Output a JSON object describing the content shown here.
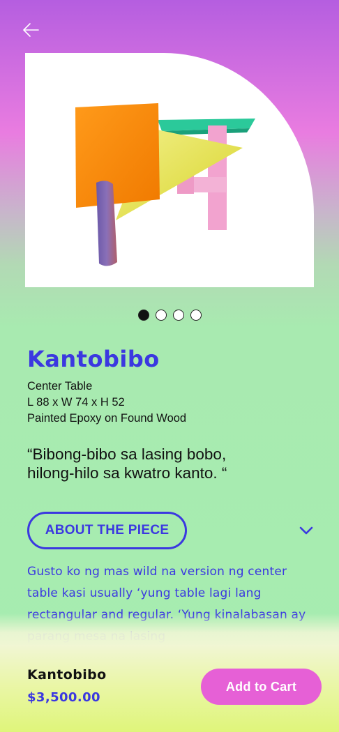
{
  "nav": {
    "back_icon": "arrow-left-icon"
  },
  "product": {
    "name": "Kantobibo",
    "type": "Center Table",
    "dimensions": "L 88 x W 74 x H 52",
    "material": "Painted Epoxy on Found Wood",
    "quote_line1": "“Bibong-bibo sa lasing bobo,",
    "quote_line2": "hilong-hilo sa kwatro kanto. “",
    "image_count": 4,
    "active_image": 1
  },
  "about": {
    "label": "ABOUT THE PIECE",
    "toggle_icon": "chevron-down-icon",
    "description": "Gusto ko ng mas wild na version ng center table kasi usually ‘yung table lagi lang rectangular and regular. ‘Yung kinalabasan ay parang mesa na lasing"
  },
  "bottom_bar": {
    "name": "Kantobibo",
    "price": "$3,500.00",
    "cart_label": "Add to Cart"
  },
  "colors": {
    "accent_blue": "#3b38e0",
    "accent_pink": "#e660d6",
    "background_top": "#b55ee0",
    "background_mid": "#a8eab0",
    "background_bottom": "#dff57a"
  }
}
